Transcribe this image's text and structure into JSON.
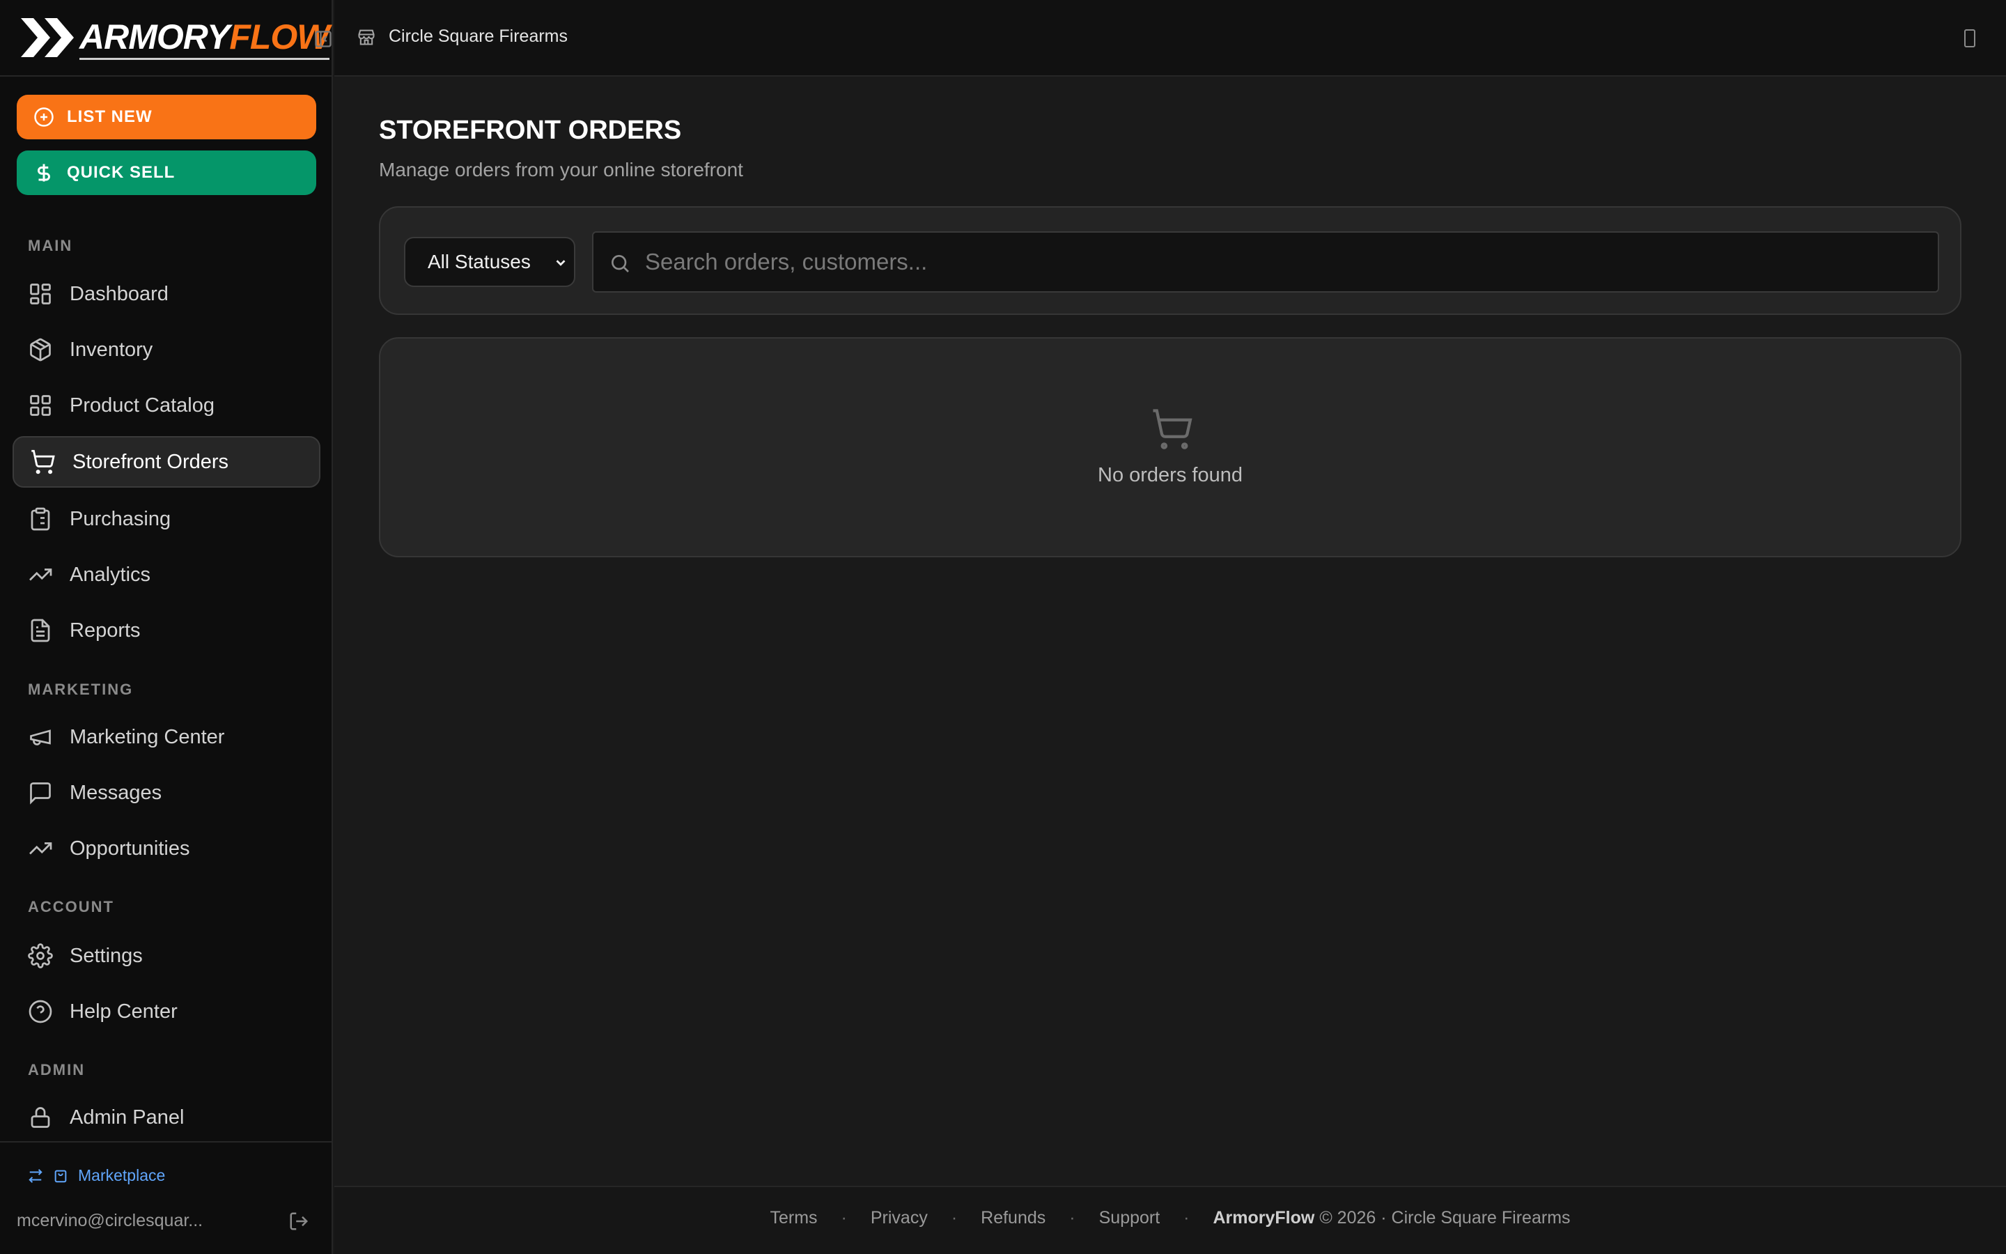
{
  "brand": {
    "logo_part1": "ARMORY",
    "logo_part2": "FLOW",
    "accent": "#f97316",
    "success": "#059669",
    "link": "#60a5fa"
  },
  "cta": {
    "list_new": "LIST NEW",
    "quick_sell": "QUICK SELL"
  },
  "sections": {
    "main": "MAIN",
    "marketing": "MARKETING",
    "account": "ACCOUNT",
    "admin": "ADMIN"
  },
  "nav": {
    "dashboard": "Dashboard",
    "inventory": "Inventory",
    "product_catalog": "Product Catalog",
    "storefront_orders": "Storefront Orders",
    "purchasing": "Purchasing",
    "analytics": "Analytics",
    "reports": "Reports",
    "marketing_center": "Marketing Center",
    "messages": "Messages",
    "opportunities": "Opportunities",
    "settings": "Settings",
    "help_center": "Help Center",
    "admin_panel": "Admin Panel"
  },
  "sidebar_footer": {
    "marketplace": "Marketplace",
    "user_email": "mcervino@circlesquar..."
  },
  "topbar": {
    "store_name": "Circle Square Firearms"
  },
  "main": {
    "title": "STOREFRONT ORDERS",
    "subtitle": "Manage orders from your online storefront",
    "status_filter": "All Statuses",
    "search_placeholder": "Search orders, customers...",
    "empty_text": "No orders found"
  },
  "footer": {
    "terms": "Terms",
    "privacy": "Privacy",
    "refunds": "Refunds",
    "support": "Support",
    "separator": "·",
    "brand": "ArmoryFlow",
    "copyright": "© 2026 · Circle Square Firearms"
  }
}
